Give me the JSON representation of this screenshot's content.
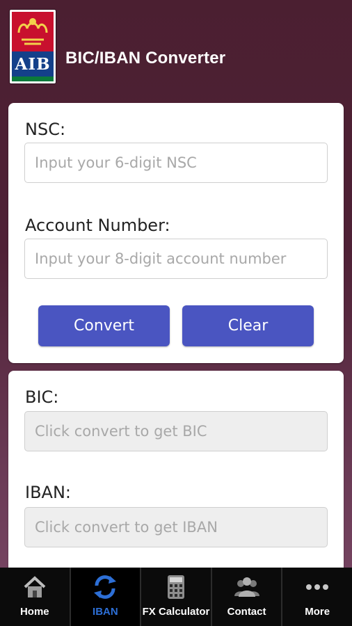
{
  "header": {
    "logo_text": "AIB",
    "title": "BIC/IBAN Converter"
  },
  "form": {
    "nsc_label": "NSC:",
    "nsc_placeholder": "Input your 6-digit NSC",
    "account_label": "Account Number:",
    "account_placeholder": "Input your 8-digit account number",
    "convert_label": "Convert",
    "clear_label": "Clear"
  },
  "results": {
    "bic_label": "BIC:",
    "bic_placeholder": "Click convert to get BIC",
    "iban_label": "IBAN:",
    "iban_placeholder": "Click convert to get IBAN"
  },
  "tabs": [
    {
      "label": "Home",
      "icon": "home-icon"
    },
    {
      "label": "IBAN",
      "icon": "refresh-icon",
      "active": true
    },
    {
      "label": "FX Calculator",
      "icon": "calculator-icon"
    },
    {
      "label": "Contact",
      "icon": "contacts-icon"
    },
    {
      "label": "More",
      "icon": "more-icon"
    }
  ],
  "colors": {
    "accent": "#4a55c1",
    "active_tab": "#2d6fd6",
    "brand_red": "#c8102e",
    "brand_blue": "#14408a",
    "brand_green": "#0b7a3b"
  }
}
